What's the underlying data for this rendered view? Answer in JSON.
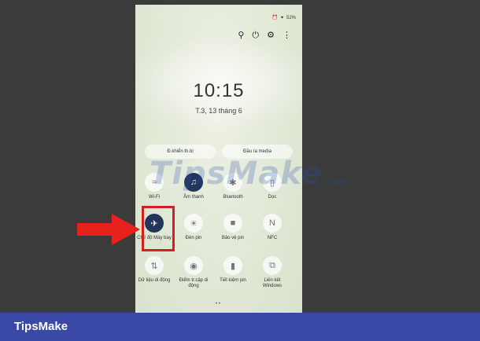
{
  "status": {
    "alarm": "⏰",
    "signal": "✦",
    "battery": "52%"
  },
  "lock": {
    "time": "10:15",
    "date": "T.3, 13 tháng 6"
  },
  "panel_buttons": {
    "device_control": "Đ.khiển th.bị",
    "media_output": "Đầu ra media"
  },
  "tiles": [
    {
      "label": "Wi-Fi",
      "icon": "wifi-icon"
    },
    {
      "label": "Âm thanh",
      "icon": "sound-icon"
    },
    {
      "label": "Bluetooth",
      "icon": "bluetooth-icon"
    },
    {
      "label": "Dọc",
      "icon": "portrait-icon"
    },
    {
      "label": "Chế độ Máy bay",
      "icon": "airplane-icon"
    },
    {
      "label": "Đèn pin",
      "icon": "flashlight-icon"
    },
    {
      "label": "Bảo vệ pin",
      "icon": "battery-protect-icon"
    },
    {
      "label": "NFC",
      "icon": "nfc-icon"
    },
    {
      "label": "Dữ liệu di động",
      "icon": "mobile-data-icon"
    },
    {
      "label": "Điểm tr.cập di động",
      "icon": "hotspot-icon"
    },
    {
      "label": "Tiết kiệm pin",
      "icon": "battery-saver-icon"
    },
    {
      "label": "Liên kết Windows",
      "icon": "link-windows-icon"
    }
  ],
  "watermark": {
    "main": "TipsMake",
    "suffix": ".com"
  },
  "footer": {
    "brand": "TipsMake"
  },
  "colors": {
    "accent": "#23355b",
    "highlight": "#d12020",
    "footer": "#3a49a6",
    "arrow": "#e8211c"
  }
}
